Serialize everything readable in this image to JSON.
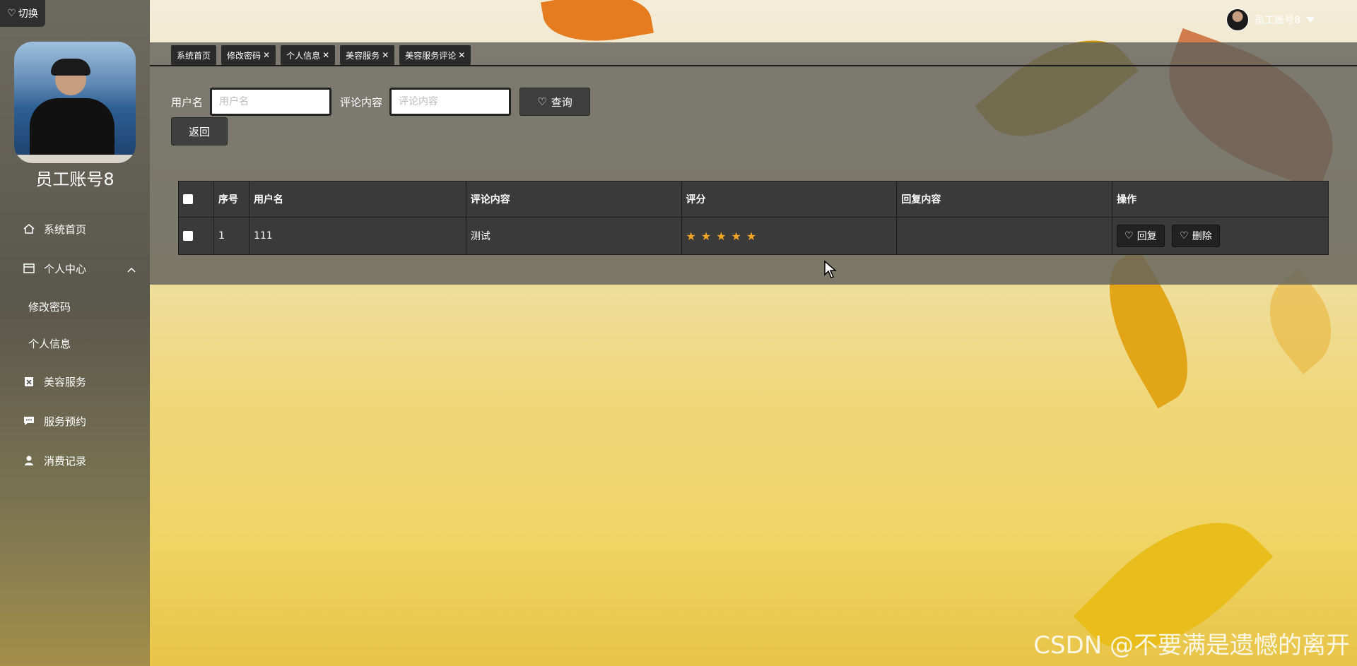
{
  "sidebar": {
    "switch_label": "切换",
    "user_name": "员工账号8",
    "items": [
      {
        "label": "系统首页",
        "icon": "home-icon"
      },
      {
        "label": "个人中心",
        "icon": "panel-icon"
      },
      {
        "label": "修改密码"
      },
      {
        "label": "个人信息"
      },
      {
        "label": "美容服务",
        "icon": "clipboard-icon"
      },
      {
        "label": "服务预约",
        "icon": "chat-icon"
      },
      {
        "label": "消费记录",
        "icon": "user-icon"
      }
    ]
  },
  "header": {
    "user_label": "员工账号8"
  },
  "tabs": [
    {
      "label": "系统首页",
      "closable": false
    },
    {
      "label": "修改密码",
      "closable": true
    },
    {
      "label": "个人信息",
      "closable": true
    },
    {
      "label": "美容服务",
      "closable": true
    },
    {
      "label": "美容服务评论",
      "closable": true
    }
  ],
  "search": {
    "username_label": "用户名",
    "username_placeholder": "用户名",
    "comment_label": "评论内容",
    "comment_placeholder": "评论内容",
    "query_label": "查询",
    "back_label": "返回"
  },
  "table": {
    "headers": [
      "序号",
      "用户名",
      "评论内容",
      "评分",
      "回复内容",
      "操作"
    ],
    "rows": [
      {
        "index": "1",
        "username": "111",
        "comment": "测试",
        "rating": 5,
        "reply": ""
      }
    ],
    "reply_label": "回复",
    "delete_label": "删除"
  },
  "watermark": "CSDN @不要满是遗憾的离开",
  "colors": {
    "star": "#f5a623",
    "panel": "#626260",
    "button": "#3f3f3f"
  }
}
